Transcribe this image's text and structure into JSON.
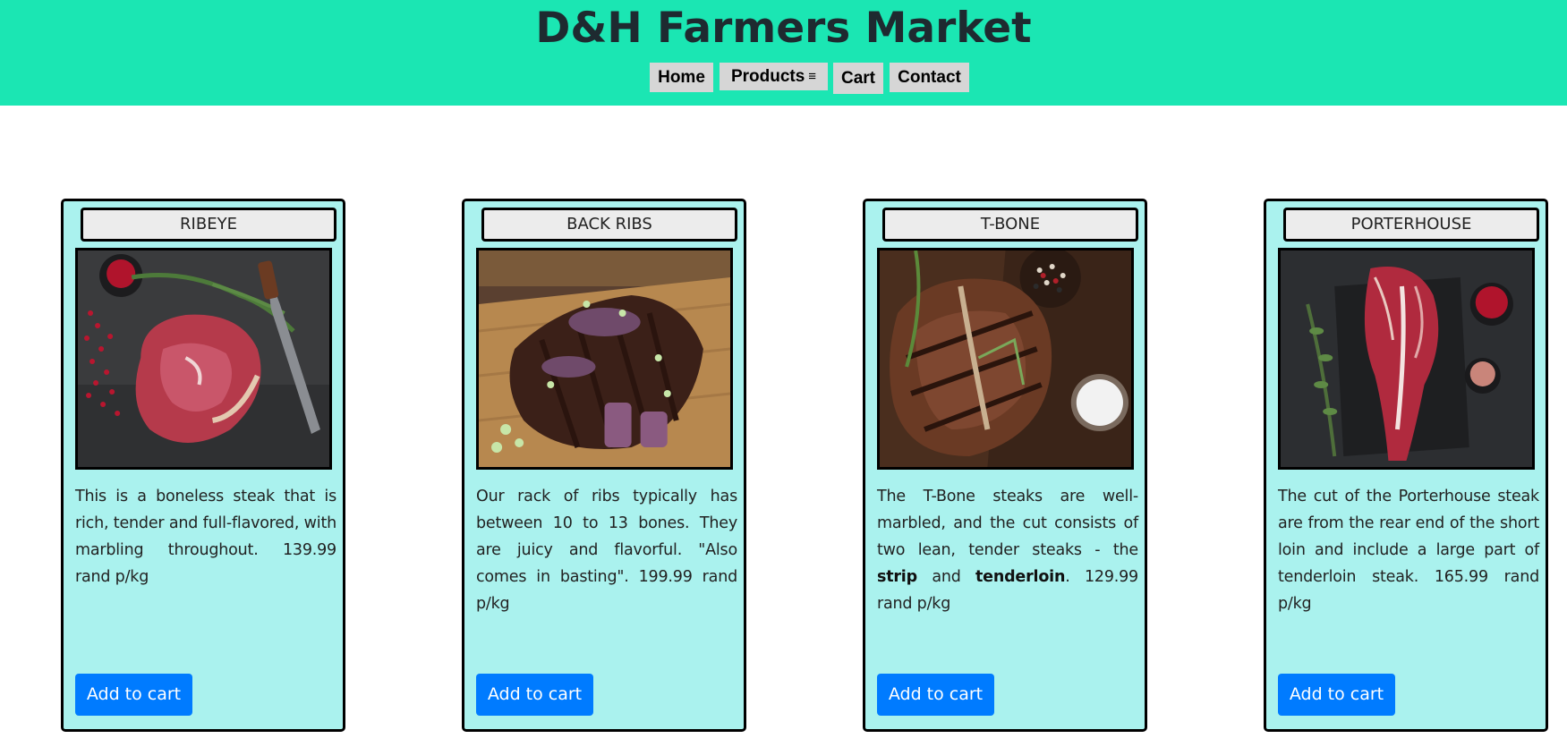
{
  "header": {
    "title": "D&H Farmers Market",
    "nav": [
      {
        "label": "Home"
      },
      {
        "label": "Products",
        "icon": "menu-icon",
        "icon_glyph": "≡"
      },
      {
        "label": "Cart"
      },
      {
        "label": "Contact"
      }
    ]
  },
  "colors": {
    "header_bg": "#1be6b3",
    "card_bg": "#aaf2ee",
    "button_bg": "#007bff"
  },
  "products": [
    {
      "name": "RIBEYE",
      "image": "ribeye-steak-image",
      "description": "This is a boneless steak that is rich, tender and full-flavored, with marbling throughout. 139.99 rand p/kg",
      "button": "Add to cart"
    },
    {
      "name": "BACK RIBS",
      "image": "back-ribs-image",
      "description": "Our rack of ribs typically has between 10 to 13 bones. They are juicy and flavorful. \"Also comes in basting\". 199.99 rand p/kg",
      "button": "Add to cart"
    },
    {
      "name": "T-BONE",
      "image": "t-bone-steak-image",
      "description_parts": {
        "before": "The T-Bone steaks are well-marbled, and the cut consists of two lean, tender steaks - the ",
        "bold1": "strip",
        "middle": " and ",
        "bold2": "tenderloin",
        "after": ". 129.99 rand p/kg"
      },
      "button": "Add to cart"
    },
    {
      "name": "PORTERHOUSE",
      "image": "porterhouse-steak-image",
      "description": "The cut of the Porterhouse steak are from the rear end of the short loin and include a large part of tenderloin steak. 165.99 rand p/kg",
      "button": "Add to cart"
    }
  ]
}
